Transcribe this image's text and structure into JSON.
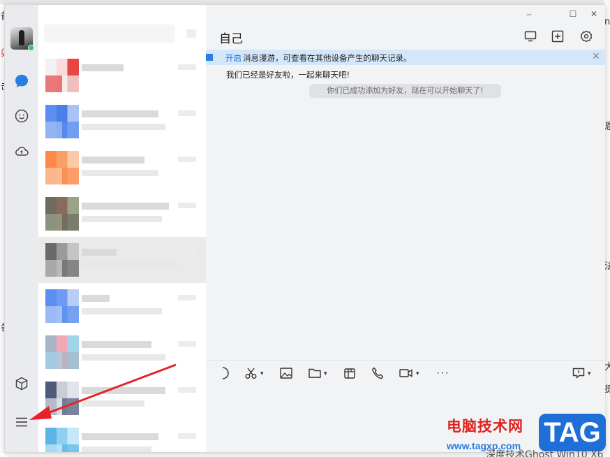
{
  "background": {
    "left_fragments": [
      "备",
      "卯",
      "击",
      "各"
    ],
    "right_fragments": [
      "n",
      "恩",
      "法",
      "大",
      "捷"
    ],
    "bottom_text": "深度技术Ghost Win10 X6"
  },
  "window": {
    "controls": {
      "minimize": "–",
      "maximize": "☐",
      "close": "✕"
    }
  },
  "rail": {
    "items": [
      {
        "name": "message",
        "active": true
      },
      {
        "name": "contacts",
        "active": false
      },
      {
        "name": "cloud",
        "active": false
      }
    ],
    "bottom": [
      {
        "name": "app-box"
      },
      {
        "name": "menu"
      }
    ]
  },
  "list": {
    "conversations": [
      {
        "colors": [
          "#f2f2f2",
          "#fbdada",
          "#e84545"
        ],
        "line1": 60,
        "line2": 0
      },
      {
        "colors": [
          "#5b8ef0",
          "#4b7ee8",
          "#a9c4f4"
        ],
        "line1": 110,
        "line2": 120
      },
      {
        "colors": [
          "#fb8a4a",
          "#f7a066",
          "#fcc9a6"
        ],
        "line1": 90,
        "line2": 110
      },
      {
        "colors": [
          "#6d6d5e",
          "#8a6a5a",
          "#9aa38a"
        ],
        "line1": 125,
        "line2": 115
      },
      {
        "colors": [
          "#6a6a6a",
          "#9a9a9a",
          "#c4c4c4"
        ],
        "line1": 50,
        "line2": 140,
        "selected": true
      },
      {
        "colors": [
          "#5b8ef0",
          "#6d9af2",
          "#b7cdf6"
        ],
        "line1": 40,
        "line2": 115
      },
      {
        "colors": [
          "#a8b4c8",
          "#f4a7b5",
          "#9fd4ea"
        ],
        "line1": 100,
        "line2": 120
      },
      {
        "colors": [
          "#4d5a7a",
          "#c8cdd6",
          "#e1e4ea"
        ],
        "line1": 120,
        "line2": 90
      },
      {
        "colors": [
          "#5ab4e6",
          "#8fd0f0",
          "#c9e8f7"
        ],
        "line1": 110,
        "line2": 100
      }
    ]
  },
  "chat": {
    "title": "自己",
    "header_buttons": [
      "screen-share",
      "add-window",
      "settings"
    ],
    "banner": {
      "link": "开启",
      "text": "消息漫游，可查看在其他设备产生的聊天记录。",
      "close": "✕"
    },
    "self_message": "我们已经是好友啦，一起来聊天吧!",
    "system_notice": "你们已成功添加为好友，现在可以开始聊天了!",
    "toolbar": {
      "more": "···"
    }
  },
  "watermark": {
    "title": "电脑技术网",
    "url": "www.tagxp.com",
    "badge": "TAG"
  },
  "colors": {
    "accent": "#1a73e8",
    "banner_bg": "#d3e6fa",
    "presence": "#37c85d",
    "arrow": "#e5222a"
  }
}
